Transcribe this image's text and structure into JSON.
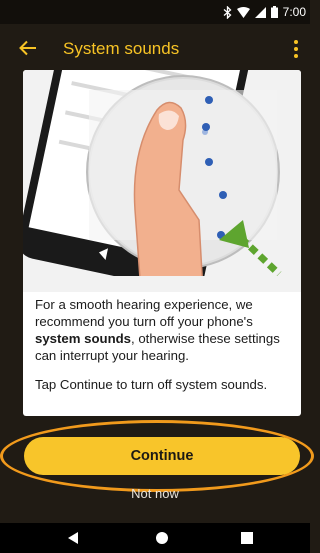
{
  "status_bar": {
    "time": "7:00",
    "icons": [
      "bluetooth-icon",
      "wifi-icon",
      "cell-signal-icon",
      "battery-icon"
    ]
  },
  "toolbar": {
    "back_icon": "arrow-left-icon",
    "title": "System sounds",
    "menu_icon": "more-vert-icon"
  },
  "card": {
    "illustration": "phone-tap-illustration",
    "text_before_bold": "For a smooth hearing experience, we recommend you turn off your phone's ",
    "text_bold": "system sounds",
    "text_after_bold": ", otherwise these settings can interrupt your hearing.",
    "text_2": "Tap Continue to turn off system sounds."
  },
  "actions": {
    "continue_label": "Continue",
    "not_now_label": "Not now"
  },
  "nav_bar": {
    "icons": [
      "nav-back-icon",
      "nav-home-icon",
      "nav-recents-icon"
    ]
  },
  "colors": {
    "accent": "#f8c52a",
    "title": "#f7c325",
    "background": "#201b14",
    "highlight_ring": "#f19a1c",
    "illustration_arrow": "#5ea52f"
  }
}
